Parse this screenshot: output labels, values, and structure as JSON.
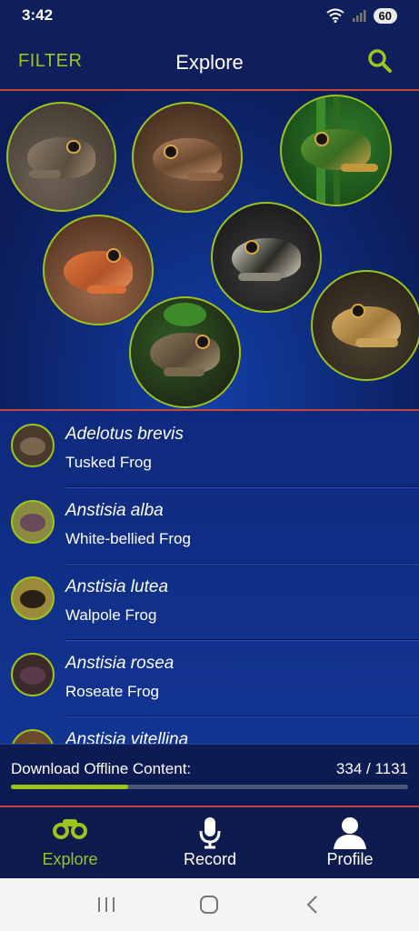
{
  "status_bar": {
    "time": "3:42",
    "battery": "60"
  },
  "header": {
    "filter_label": "FILTER",
    "title": "Explore"
  },
  "hero": {
    "bubbles": [
      "frog-photo-1",
      "frog-photo-2",
      "frog-photo-3",
      "frog-photo-4",
      "frog-photo-5",
      "frog-photo-6",
      "frog-photo-7"
    ]
  },
  "species": [
    {
      "scientific": "Adelotus brevis",
      "common": "Tusked Frog"
    },
    {
      "scientific": "Anstisia alba",
      "common": "White-bellied Frog"
    },
    {
      "scientific": "Anstisia lutea",
      "common": "Walpole Frog"
    },
    {
      "scientific": "Anstisia rosea",
      "common": "Roseate Frog"
    },
    {
      "scientific": "Anstisia vitellina",
      "common": ""
    }
  ],
  "download": {
    "label": "Download Offline Content:",
    "count": "334 / 1131",
    "progress": 0.295
  },
  "tabs": {
    "explore": "Explore",
    "record": "Record",
    "profile": "Profile"
  },
  "colors": {
    "accent": "#9ec31b",
    "divider": "#c0483e",
    "background": "#0f1f5c"
  }
}
